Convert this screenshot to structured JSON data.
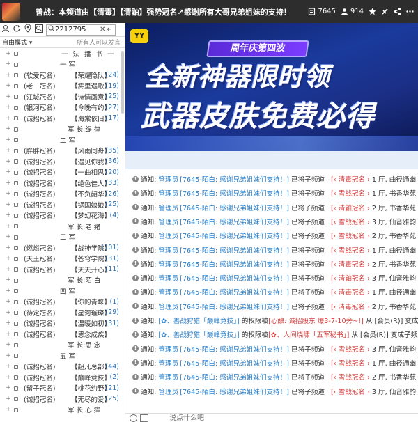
{
  "topbar": {
    "channel_name": "善战：本频道由【清毒】【清鼬】强势冠名↗感谢所有大哥兄弟姐妹的支持！",
    "online_count": "7645",
    "user_count": "914"
  },
  "left": {
    "search_value": "2212795",
    "mode_label": "自由模式 ▾",
    "mode_hint": "所有人可以发言",
    "tree": [
      {
        "type": "header",
        "label": "一 法 播 书 一"
      },
      {
        "type": "group",
        "label": "一 军"
      },
      {
        "type": "user",
        "role": "(软爱冠名)",
        "name": "【荣耀隐队】",
        "count": "(24)"
      },
      {
        "type": "user",
        "role": "(老二冠名)",
        "name": "【雾里遇歌】",
        "count": "(19)"
      },
      {
        "type": "user",
        "role": "(江城冠名)",
        "name": "【诗情画意】",
        "count": "(25)"
      },
      {
        "type": "user",
        "role": "(银河冠名)",
        "name": "【今晚有约】",
        "count": "(27)"
      },
      {
        "type": "user",
        "role": "(诚招冠名)",
        "name": "【海棠依旧】",
        "count": "(17)"
      },
      {
        "type": "leader",
        "label": "军 长:缇 律"
      },
      {
        "type": "group",
        "label": "二 军"
      },
      {
        "type": "user",
        "role": "(胖胖冠名)",
        "name": "【风雨同舟】",
        "count": "(35)"
      },
      {
        "type": "user",
        "role": "(诚招冠名)",
        "name": "【遇见你我】",
        "count": "(36)"
      },
      {
        "type": "user",
        "role": "(诚招冠名)",
        "name": "【一曲相思】",
        "count": "(20)"
      },
      {
        "type": "user",
        "role": "(诚招冠名)",
        "name": "【绝色佳人】",
        "count": "(33)"
      },
      {
        "type": "user",
        "role": "(诚招冠名)",
        "name": "【不负韶华】",
        "count": "(26)"
      },
      {
        "type": "user",
        "role": "(诚招冠名)",
        "name": "【锅国娘娘】",
        "count": "(25)"
      },
      {
        "type": "user",
        "role": "(诚招冠名)",
        "name": "【梦幻花海】",
        "count": "(4)"
      },
      {
        "type": "leader",
        "label": "军 长:老 猪"
      },
      {
        "type": "group",
        "label": "三 军"
      },
      {
        "type": "user",
        "role": "(燃燃冠名)",
        "name": "【战神学院】",
        "count": "(101)"
      },
      {
        "type": "user",
        "role": "(天王冠名)",
        "name": "【苍穹学院】",
        "count": "(31)"
      },
      {
        "type": "user",
        "role": "(诚招冠名)",
        "name": "【天天开心】",
        "count": "(11)"
      },
      {
        "type": "leader",
        "label": "军 长:陌 白"
      },
      {
        "type": "group",
        "label": "四 军"
      },
      {
        "type": "user",
        "role": "(诚招冠名)",
        "name": "【你的青睐】",
        "count": "(1)"
      },
      {
        "type": "user",
        "role": "(待定冠名)",
        "name": "【星河璀璨】",
        "count": "(29)"
      },
      {
        "type": "user",
        "role": "(诚招冠名)",
        "name": "【温暖如初】",
        "count": "(31)"
      },
      {
        "type": "user",
        "role": "(诚招冠名)",
        "name": "【思念成疾】",
        "count": ""
      },
      {
        "type": "leader",
        "label": "军 长:思 念"
      },
      {
        "type": "group",
        "label": "五 军"
      },
      {
        "type": "user",
        "role": "(诚招冠名)",
        "name": "【超凡总部】",
        "count": "(44)"
      },
      {
        "type": "user",
        "role": "(诚招冠名)",
        "name": "【巅峰竞技】",
        "count": "(2)"
      },
      {
        "type": "user",
        "role": "(留子冠名)",
        "name": "【桃花约野】",
        "count": "(21)"
      },
      {
        "type": "user",
        "role": "(诚招冠名)",
        "name": "【无尽的爱】",
        "count": "(25)"
      },
      {
        "type": "leader",
        "label": "军 长:心 痒"
      }
    ]
  },
  "banner": {
    "logo": "YY",
    "tag": "周年庆第四波",
    "line1": "全新神器限时领",
    "line2": "武器皮肤免费必得"
  },
  "messages": [
    {
      "kind": "std",
      "label": "通知:",
      "admin": "管理员",
      "who": "[7645-陌白: 感谢兄弟姐妹们支持！]",
      "txt": "已将子频道",
      "tail1": "[‹ 清毒冠名 ›",
      "tail2": "1 厅, 曲径通幽"
    },
    {
      "kind": "std",
      "label": "通知:",
      "admin": "管理员",
      "who": "[7645-陌白: 感谢兄弟姐妹们支持！]",
      "txt": "已将子频道",
      "tail1": "[‹ 雪战冠名 ›",
      "tail2": "1 厅, 书香华苑"
    },
    {
      "kind": "std",
      "label": "通知:",
      "admin": "管理员",
      "who": "[7645-陌白: 感谢兄弟姐妹们支持！]",
      "txt": "已将子频道",
      "tail1": "[‹ 清鼬冠名 ›",
      "tail2": "2 厅, 书香华苑"
    },
    {
      "kind": "std",
      "label": "通知:",
      "admin": "管理员",
      "who": "[7645-陌白: 感谢兄弟姐妹们支持！]",
      "txt": "已将子频道",
      "tail1": "[‹ 雪战冠名 ›",
      "tail2": "3 厅, 仙音雅韵"
    },
    {
      "kind": "std",
      "label": "通知:",
      "admin": "管理员",
      "who": "[7645-陌白: 感谢兄弟姐妹们支持！]",
      "txt": "已将子频道",
      "tail1": "[‹ 雪战冠名 ›",
      "tail2": "2 厅, 书香华苑"
    },
    {
      "kind": "std",
      "label": "通知:",
      "admin": "管理员",
      "who": "[7645-陌白: 感谢兄弟姐妹们支持！]",
      "txt": "已将子频道",
      "tail1": "[‹ 雪战冠名 ›",
      "tail2": "1 厅, 曲径通幽"
    },
    {
      "kind": "std",
      "label": "通知:",
      "admin": "管理员",
      "who": "[7645-陌白: 感谢兄弟姐妹们支持！]",
      "txt": "已将子频道",
      "tail1": "[‹ 清毒冠名 ›",
      "tail2": "2 厅, 书香华苑"
    },
    {
      "kind": "std",
      "label": "通知:",
      "admin": "管理员",
      "who": "[7645-陌白: 感谢兄弟姐妹们支持！]",
      "txt": "已将子频道",
      "tail1": "[‹ 清鼬冠名 ›",
      "tail2": "3 厅, 仙音雅韵"
    },
    {
      "kind": "std",
      "label": "通知:",
      "admin": "管理员",
      "who": "[7645-陌白: 感谢兄弟姐妹们支持！]",
      "txt": "已将子频道",
      "tail1": "[‹ 清毒冠名 ›",
      "tail2": "1 厅, 曲径通幽"
    },
    {
      "kind": "std",
      "label": "通知:",
      "admin": "管理员",
      "who": "[7645-陌白: 感谢兄弟姐妹们支持！]",
      "txt": "已将子频道",
      "tail1": "[‹ 清毒冠名 ›",
      "tail2": "2 厅, 书香华苑"
    },
    {
      "kind": "perm",
      "label": "通知:",
      "who": "[✿、善战狩猎「巅峰竞技」]",
      "txt": "的权限被",
      "chan": "[心酿: 诚招股东 爆3-7-10旁~!]",
      "tail": "从 [会员(R)] 变成子频道 ["
    },
    {
      "kind": "perm",
      "label": "通知:",
      "who": "[✿、善战狩猎「巅峰竞技」]",
      "txt": "的权限被",
      "chan": "[✿、人间烧啸「五军秘书」]",
      "tail": "从 [会员(R)] 变成子频道 ["
    },
    {
      "kind": "std",
      "label": "通知:",
      "admin": "管理员",
      "who": "[7645-陌白: 感谢兄弟姐妹们支持！]",
      "txt": "已将子频道",
      "tail1": "[‹ 雪战冠名 ›",
      "tail2": "3 厅, 仙音雅韵"
    },
    {
      "kind": "std",
      "label": "通知:",
      "admin": "管理员",
      "who": "[7645-陌白: 感谢兄弟姐妹们支持！]",
      "txt": "已将子频道",
      "tail1": "[‹ 雪战冠名 ›",
      "tail2": "1 厅, 曲径通幽"
    },
    {
      "kind": "std",
      "label": "通知:",
      "admin": "管理员",
      "who": "[7645-陌白: 感谢兄弟姐妹们支持！]",
      "txt": "已将子频道",
      "tail1": "[‹ 雪战冠名 ›",
      "tail2": "2 厅, 书香华苑"
    },
    {
      "kind": "std",
      "label": "通知:",
      "admin": "管理员",
      "who": "[7645-陌白: 感谢兄弟姐妹们支持！]",
      "txt": "已将子频道",
      "tail1": "[‹ 雪战冠名 ›",
      "tail2": "3 厅, 仙音雅韵"
    }
  ],
  "input": {
    "placeholder": "说点什么吧"
  }
}
